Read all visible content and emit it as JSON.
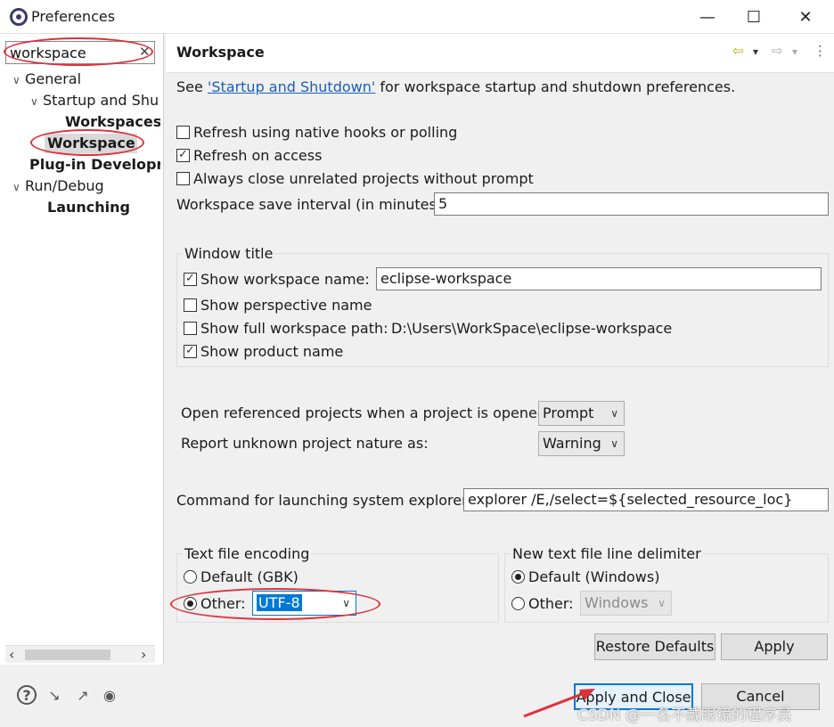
{
  "window": {
    "title": "Preferences",
    "minimize": "—",
    "maximize": "☐",
    "close": "✕"
  },
  "search": {
    "value": "workspace",
    "clear_icon": "✕"
  },
  "tree": {
    "general": "General",
    "startup": "Startup and Shu",
    "workspaces": "Workspaces",
    "workspace": "Workspace",
    "plugin": "Plug-in Developr",
    "rundebug": "Run/Debug",
    "launching": "Launching",
    "expanded_icon": "∨",
    "collapsed_icon": "›"
  },
  "scroll": {
    "left": "‹",
    "right": "›"
  },
  "pane": {
    "title": "Workspace",
    "back": "⇦",
    "forward": "⇨",
    "dropdown": "▾",
    "menu": "⋮"
  },
  "intro": {
    "prefix": "See ",
    "link": "'Startup and Shutdown'",
    "suffix": " for workspace startup and shutdown preferences."
  },
  "options": {
    "refresh_hooks": {
      "label": "Refresh using native hooks or polling",
      "checked": false
    },
    "refresh_access": {
      "label": "Refresh on access",
      "checked": true
    },
    "always_close": {
      "label": "Always close unrelated projects without prompt",
      "checked": false
    }
  },
  "save_interval": {
    "label": "Workspace save interval (in minutes):",
    "value": "5"
  },
  "window_title_group": {
    "label": "Window title",
    "show_ws_name": {
      "label": "Show workspace name:",
      "checked": true,
      "value": "eclipse-workspace"
    },
    "show_perspective": {
      "label": "Show perspective name",
      "checked": false
    },
    "show_full_path": {
      "label": "Show full workspace path:",
      "checked": false,
      "value": "D:\\Users\\WorkSpace\\eclipse-workspace"
    },
    "show_product": {
      "label": "Show product name",
      "checked": true
    }
  },
  "open_referenced": {
    "label": "Open referenced projects when a project is opened:",
    "value": "Prompt"
  },
  "report_unknown": {
    "label": "Report unknown project nature as:",
    "value": "Warning"
  },
  "explorer_cmd": {
    "label": "Command for launching system explorer:",
    "value": "explorer /E,/select=${selected_resource_loc}"
  },
  "encoding": {
    "label": "Text file encoding",
    "default_label": "Default (GBK)",
    "default_selected": false,
    "other_label": "Other:",
    "other_selected": true,
    "other_value": "UTF-8"
  },
  "delimiter": {
    "label": "New text file line delimiter",
    "default_label": "Default (Windows)",
    "default_selected": true,
    "other_label": "Other:",
    "other_value": "Windows"
  },
  "buttons": {
    "restore": "Restore Defaults",
    "apply": "Apply",
    "apply_close": "Apply and Close",
    "cancel": "Cancel"
  },
  "bottom_icons": {
    "help": "?",
    "import": "↘",
    "export": "↗",
    "record": "◉"
  },
  "watermark": "CSDN @一名不戴眼镜的程序员",
  "colors": {
    "annotation_red": "#e0303a",
    "link_blue": "#1a5fb4",
    "selection_blue": "#0078d7"
  }
}
